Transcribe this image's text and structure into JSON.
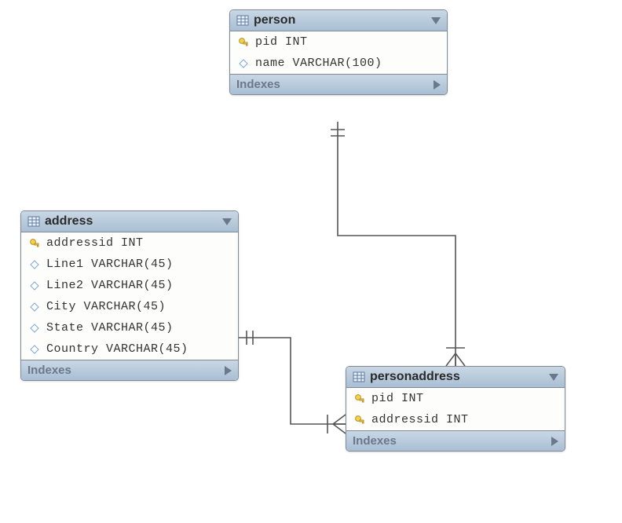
{
  "diagram": {
    "entities": {
      "person": {
        "name": "person",
        "footer": "Indexes",
        "columns": [
          {
            "icon": "key",
            "text": "pid INT"
          },
          {
            "icon": "diamond",
            "text": "name VARCHAR(100)"
          }
        ]
      },
      "address": {
        "name": "address",
        "footer": "Indexes",
        "columns": [
          {
            "icon": "key",
            "text": "addressid INT"
          },
          {
            "icon": "diamond",
            "text": "Line1 VARCHAR(45)"
          },
          {
            "icon": "diamond",
            "text": "Line2 VARCHAR(45)"
          },
          {
            "icon": "diamond",
            "text": "City VARCHAR(45)"
          },
          {
            "icon": "diamond",
            "text": "State VARCHAR(45)"
          },
          {
            "icon": "diamond",
            "text": "Country VARCHAR(45)"
          }
        ]
      },
      "personaddress": {
        "name": "personaddress",
        "footer": "Indexes",
        "columns": [
          {
            "icon": "key",
            "text": "pid INT"
          },
          {
            "icon": "key",
            "text": "addressid INT"
          }
        ]
      }
    },
    "relationships": [
      {
        "from": "person",
        "to": "personaddress",
        "type": "one-to-many"
      },
      {
        "from": "address",
        "to": "personaddress",
        "type": "one-to-many"
      }
    ]
  }
}
